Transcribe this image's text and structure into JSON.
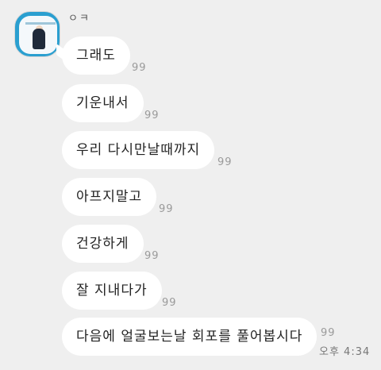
{
  "sender": {
    "name": "ㅇㅋ",
    "avatar": "profile-image"
  },
  "messages": [
    {
      "text": "그래도",
      "read_count": "99"
    },
    {
      "text": "기운내서",
      "read_count": "99"
    },
    {
      "text": "우리 다시만날때까지",
      "read_count": "99"
    },
    {
      "text": "아프지말고",
      "read_count": "99"
    },
    {
      "text": "건강하게",
      "read_count": "99"
    },
    {
      "text": "잘 지내다가",
      "read_count": "99"
    },
    {
      "text": "다음에 얼굴보는날 회포를 풀어봅시다",
      "read_count": "99"
    }
  ],
  "timestamp": "오후 4:34",
  "colors": {
    "background": "#efefef",
    "bubble": "#ffffff",
    "read_count": "#9a9a9a"
  }
}
